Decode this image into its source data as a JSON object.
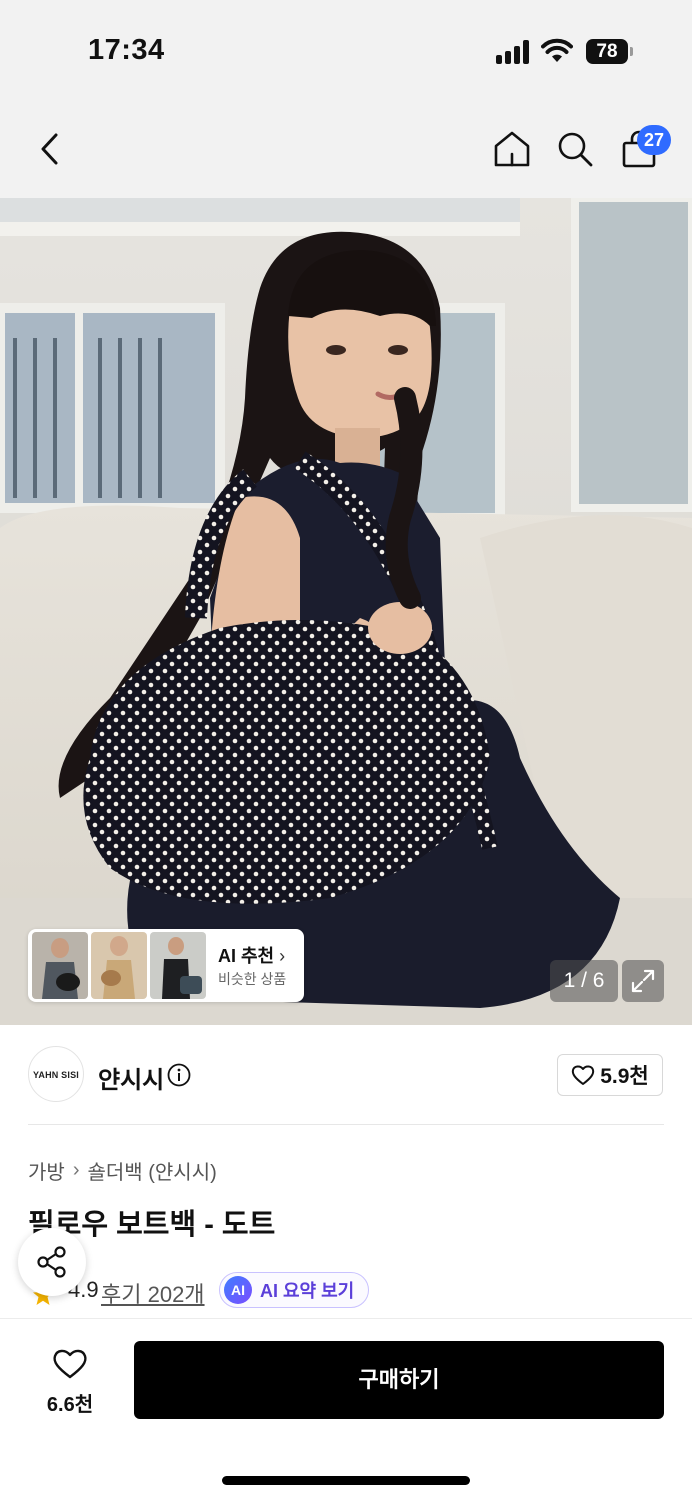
{
  "status_bar": {
    "time": "17:34",
    "battery": "78"
  },
  "nav": {
    "cart_count": "27",
    "icons": [
      "back-icon",
      "home-icon",
      "search-icon",
      "bag-icon"
    ]
  },
  "gallery": {
    "counter": "1 / 6",
    "ai_recommend": {
      "title": "AI 추천",
      "subtitle": "비슷한 상품"
    }
  },
  "brand": {
    "logo_text": "YAHN SISI",
    "name": "얀시시",
    "likes": "5.9천"
  },
  "product": {
    "breadcrumb": [
      "가방",
      "숄더백 (얀시시)"
    ],
    "title": "필로우 보트백 - 도트",
    "rating": "4.9",
    "reviews": "후기 202개",
    "ai_summary_badge": "AI",
    "ai_summary_label": "AI 요약 보기"
  },
  "bottom_bar": {
    "wish_count": "6.6천",
    "buy_label": "구매하기"
  },
  "colors": {
    "accent_blue": "#2f6bff",
    "ai_purple": "#5b3fd9",
    "star": "#f5b400",
    "buy_button": "#000000"
  }
}
